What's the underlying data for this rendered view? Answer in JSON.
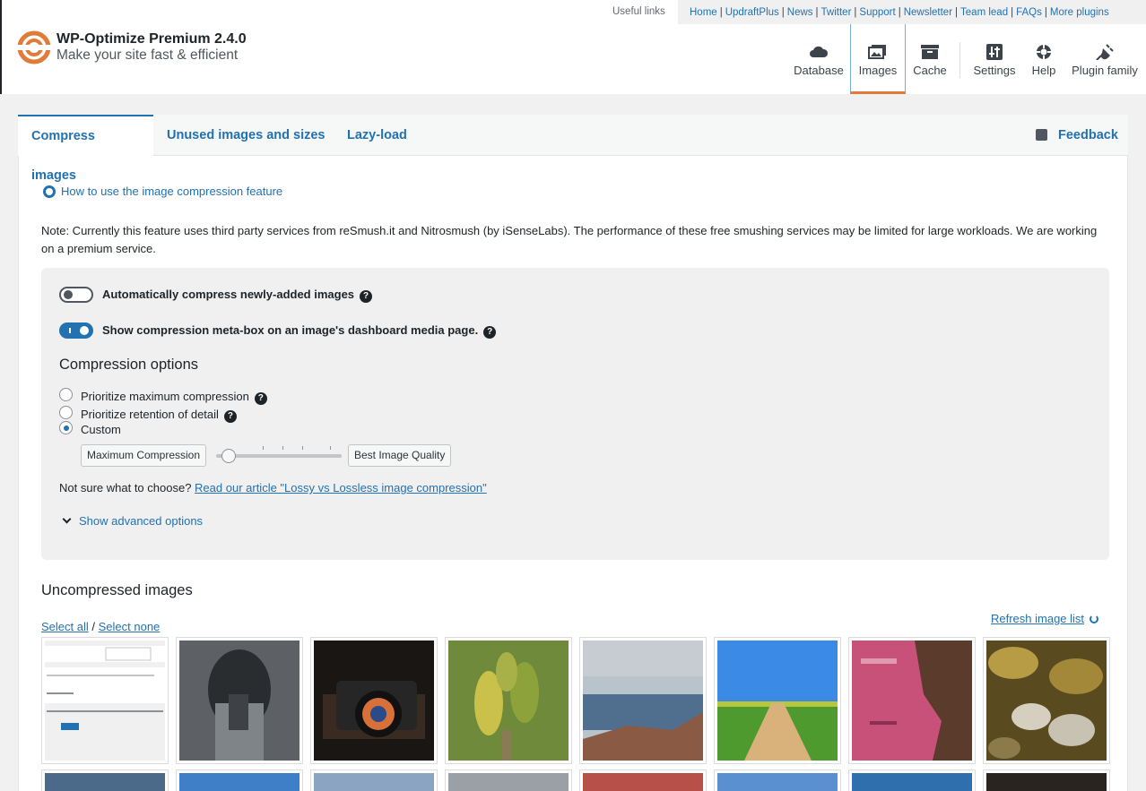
{
  "header": {
    "useful_links_label": "Useful links",
    "links": [
      "Home",
      "UpdraftPlus",
      "News",
      "Twitter",
      "Support",
      "Newsletter",
      "Team lead",
      "FAQs",
      "More plugins"
    ],
    "brand_title": "WP-Optimize Premium 2.4.0",
    "brand_subtitle": "Make your site fast & efficient",
    "nav": [
      {
        "label": "Database",
        "icon": "cloud-icon"
      },
      {
        "label": "Images",
        "icon": "images-icon"
      },
      {
        "label": "Cache",
        "icon": "archive-icon"
      },
      {
        "label": "Settings",
        "icon": "settings-icon"
      },
      {
        "label": "Help",
        "icon": "lifebuoy-icon"
      },
      {
        "label": "Plugin family",
        "icon": "plug-icon"
      }
    ],
    "active_nav": "Images",
    "accent_color": "#e07b39"
  },
  "tabs": {
    "items": [
      "Compress images",
      "Unused images and sizes",
      "Lazy-load"
    ],
    "active": "Compress images",
    "feedback": "Feedback"
  },
  "content": {
    "howto": "How to use the image compression feature",
    "note": "Note: Currently this feature uses third party services from reSmush.it and Nitrosmush (by iSenseLabs). The performance of these free smushing services may be limited for large workloads. We are working on a premium service.",
    "auto_compress_label": "Automatically compress newly-added images",
    "auto_compress_enabled": false,
    "meta_box_label": "Show compression meta-box on an image's dashboard media page.",
    "meta_box_enabled": true,
    "compression_title": "Compression options",
    "radio_options": [
      "Prioritize maximum compression",
      "Prioritize retention of detail",
      "Custom"
    ],
    "selected_option": "Custom",
    "slider_min_label": "Maximum Compression",
    "slider_max_label": "Best Image Quality",
    "slider_value": 0.05,
    "notsure_text": "Not sure what to choose?",
    "notsure_link": "Read our article \"Lossy vs Lossless image compression\"",
    "advanced_link": "Show advanced options",
    "uncompressed_title": "Uncompressed images",
    "select_all": "Select all",
    "select_sep": "/",
    "select_none": "Select none",
    "refresh": "Refresh image list",
    "help_glyph": "?"
  }
}
